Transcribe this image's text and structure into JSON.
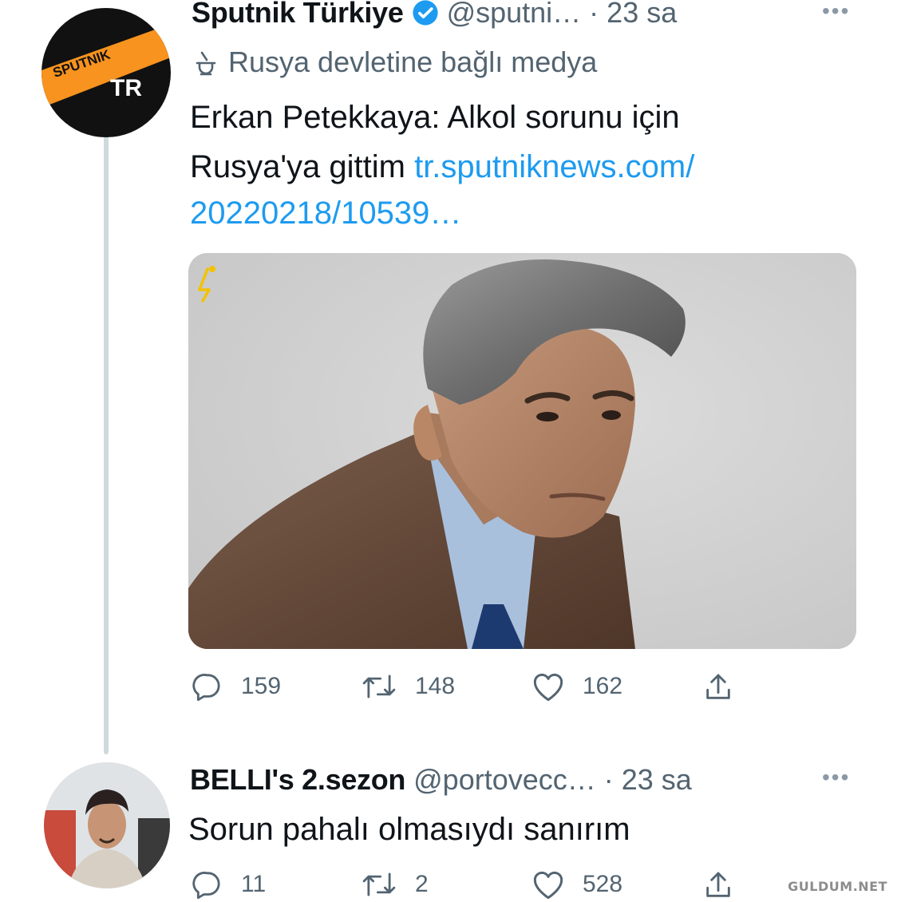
{
  "tweet1": {
    "avatar": {
      "logo_text": "SPUTNIK",
      "badge_text": "TR",
      "colors": {
        "black": "#111111",
        "orange": "#f7931e"
      }
    },
    "display_name": "Sputnik Türkiye",
    "verified_icon": "verified-badge-icon",
    "handle": "@sputni…",
    "separator": "·",
    "time": "23 sa",
    "more_icon": "more-horizontal-icon",
    "label_icon": "state-media-icon",
    "label": "Rusya devletine bağlı medya",
    "text_line1": "Erkan Petekkaya: Alkol sorunu için",
    "text_line2": "Rusya'ya gittim",
    "link_line1": "tr.sputniknews.com/",
    "link_line2": "20220218/10539…",
    "media_icon": "sputnik-lightning-icon",
    "stats": {
      "replies": "159",
      "retweets": "148",
      "likes": "162"
    }
  },
  "tweet2": {
    "display_name": "BELLI's 2.sezon",
    "handle": "@portovecc…",
    "separator": "·",
    "time": "23 sa",
    "more_icon": "more-horizontal-icon",
    "text": "Sorun pahalı olmasıydı sanırım",
    "stats": {
      "replies": "11",
      "retweets": "2",
      "likes": "528"
    }
  },
  "icons": {
    "reply": "reply-icon",
    "retweet": "retweet-icon",
    "like": "heart-icon",
    "share": "share-icon"
  },
  "colors": {
    "link": "#1d9bf0",
    "verified": "#1d9bf0",
    "muted": "#536471",
    "thread_line": "#cfd9de"
  },
  "watermark": "GULDUM.NET"
}
